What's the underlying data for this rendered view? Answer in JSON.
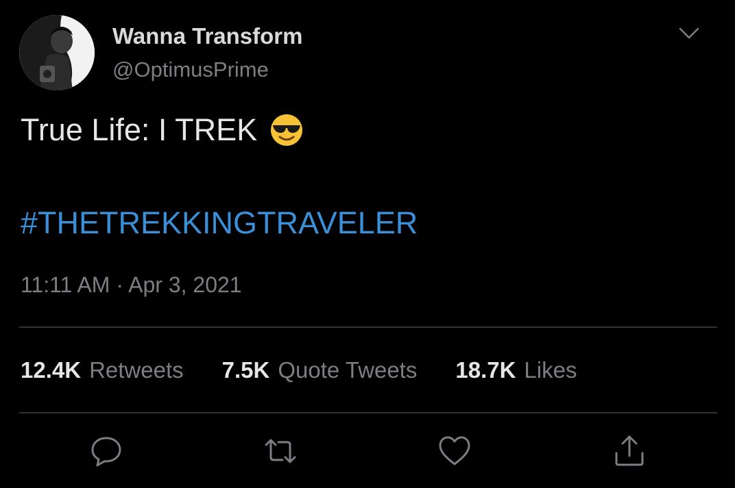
{
  "tweet": {
    "author": {
      "display_name": "Wanna Transform",
      "handle": "@OptimusPrime",
      "avatar_icon": "profile-photo"
    },
    "menu_icon": "chevron-down-icon",
    "text": "True Life: I TREK",
    "emoji": "smiling-face-with-sunglasses",
    "hashtag": "#THETREKKINGTRAVELER",
    "timestamp": "11:11 AM · Apr 3, 2021",
    "stats": {
      "retweets_count": "12.4K",
      "retweets_label": "Retweets",
      "quotes_count": "7.5K",
      "quotes_label": "Quote Tweets",
      "likes_count": "18.7K",
      "likes_label": "Likes"
    },
    "actions": [
      "reply-icon",
      "retweet-icon",
      "like-icon",
      "share-icon"
    ]
  },
  "colors": {
    "background": "#000000",
    "primary_text": "#e6e6e6",
    "secondary_text": "#7b7f84",
    "link": "#3a90d8",
    "divider": "#2f3236"
  }
}
